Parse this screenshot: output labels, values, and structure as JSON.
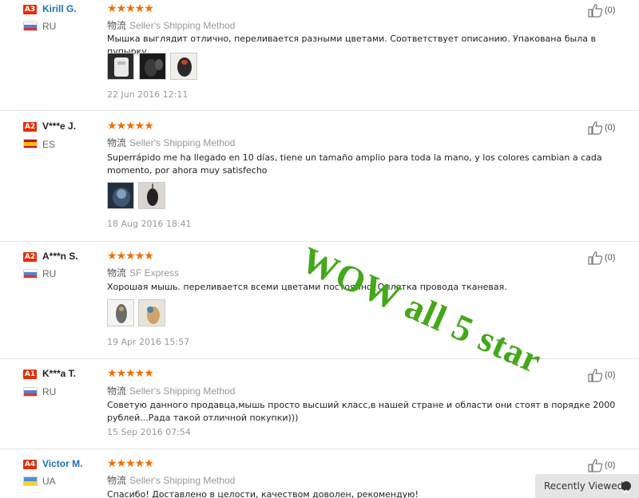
{
  "reviews": [
    {
      "level": "A3",
      "name": "Kirill G.",
      "country_code": "RU",
      "stars": "★★★★★",
      "ship_label": "物流",
      "shipping": "Seller's Shipping Method",
      "text": "Мышка выглядит отлично, переливается разными цветами. Соответствует описанию. Упакована была в пупырку.",
      "photos": [
        "photo-1",
        "photo-2",
        "photo-3"
      ],
      "date": "22 Jun 2016 12:11",
      "helpful": "(0)"
    },
    {
      "level": "A2",
      "name": "V***e J.",
      "country_code": "ES",
      "stars": "★★★★★",
      "ship_label": "物流",
      "shipping": "Seller's Shipping Method",
      "text": "Superrápido me ha llegado en 10 días, tiene un tamaño amplio para toda la mano, y los colores cambian a cada momento, por ahora muy satisfecho",
      "photos": [
        "photo-1",
        "photo-2"
      ],
      "date": "18 Aug 2016 18:41",
      "helpful": "(0)"
    },
    {
      "level": "A2",
      "name": "A***n S.",
      "country_code": "RU",
      "stars": "★★★★★",
      "ship_label": "物流",
      "shipping": "SF Express",
      "text": "Хорошая мышь. переливается всеми цветами постоянно. Оплетка провода тканевая.",
      "photos": [
        "photo-1",
        "photo-2"
      ],
      "date": "19 Apr 2016 15:57",
      "helpful": "(0)"
    },
    {
      "level": "A1",
      "name": "K***a T.",
      "country_code": "RU",
      "stars": "★★★★★",
      "ship_label": "物流",
      "shipping": "Seller's Shipping Method",
      "text": "Советую данного продавца,мышь просто высший класс,в нашей стране и области они стоят в порядке 2000 рублей...Рада такой отличной покупки)))",
      "photos": [],
      "date": "15 Sep 2016 07:54",
      "helpful": "(0)"
    },
    {
      "level": "A4",
      "name": "Victor M.",
      "country_code": "UA",
      "stars": "★★★★★",
      "ship_label": "物流",
      "shipping": "Seller's Shipping Method",
      "text": "Спасибо! Доставлено в целости, качеством доволен, рекомендую!",
      "photos": [],
      "date": "",
      "helpful": "(0)"
    }
  ],
  "overlay": {
    "watermark": "WOW all 5 star"
  },
  "recently_viewed": {
    "label": "Recently Viewed"
  },
  "colors": {
    "star": "#f36e00",
    "level_badge": "#e62e04",
    "watermark": "#44a81b",
    "link_name": "#1d6fb8"
  }
}
